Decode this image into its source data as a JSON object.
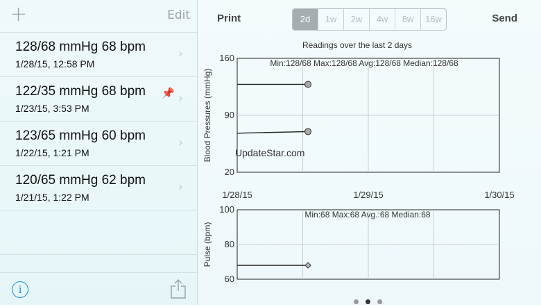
{
  "left": {
    "add_icon": "plus-icon",
    "edit_label": "Edit",
    "readings": [
      {
        "title": "128/68 mmHg 68 bpm",
        "date": "1/28/15, 12:58 PM",
        "pinned": false
      },
      {
        "title": "122/35 mmHg 68 bpm",
        "date": "1/23/15, 3:53 PM",
        "pinned": true
      },
      {
        "title": "123/65 mmHg 60 bpm",
        "date": "1/22/15, 1:21 PM",
        "pinned": false
      },
      {
        "title": "120/65 mmHg 62 bpm",
        "date": "1/21/15, 1:22 PM",
        "pinned": false
      }
    ],
    "info_glyph": "i",
    "share_icon": "share-icon"
  },
  "right": {
    "print_label": "Print",
    "send_label": "Send",
    "ranges": [
      "2d",
      "1w",
      "2w",
      "4w",
      "8w",
      "16w"
    ],
    "active_range": "2d",
    "watermark": "UpdateStar.com",
    "page_count": 3,
    "active_page": 1
  },
  "chart_data": [
    {
      "type": "line",
      "title": "Readings over the last 2 days",
      "annotation": "Min:128/68 Max:128/68 Avg:128/68 Median:128/68",
      "ylabel": "Blood Pressures (mmHg)",
      "ylim": [
        20,
        160
      ],
      "yticks": [
        160,
        90,
        20
      ],
      "xticks": [
        "1/28/15",
        "1/29/15",
        "1/30/15"
      ],
      "grid": true,
      "series": [
        {
          "values": [
            [
              0,
              128
            ],
            [
              0.54,
              128
            ]
          ]
        },
        {
          "values": [
            [
              0,
              68
            ],
            [
              0.54,
              70
            ]
          ]
        }
      ]
    },
    {
      "type": "line",
      "annotation": "Min:68 Max:68 Avg.:68 Median:68",
      "ylabel": "Pulse (bpm)",
      "ylim": [
        60,
        100
      ],
      "yticks": [
        100,
        80,
        60
      ],
      "grid": true,
      "series": [
        {
          "values": [
            [
              0,
              68
            ],
            [
              0.54,
              68
            ]
          ]
        }
      ]
    }
  ]
}
